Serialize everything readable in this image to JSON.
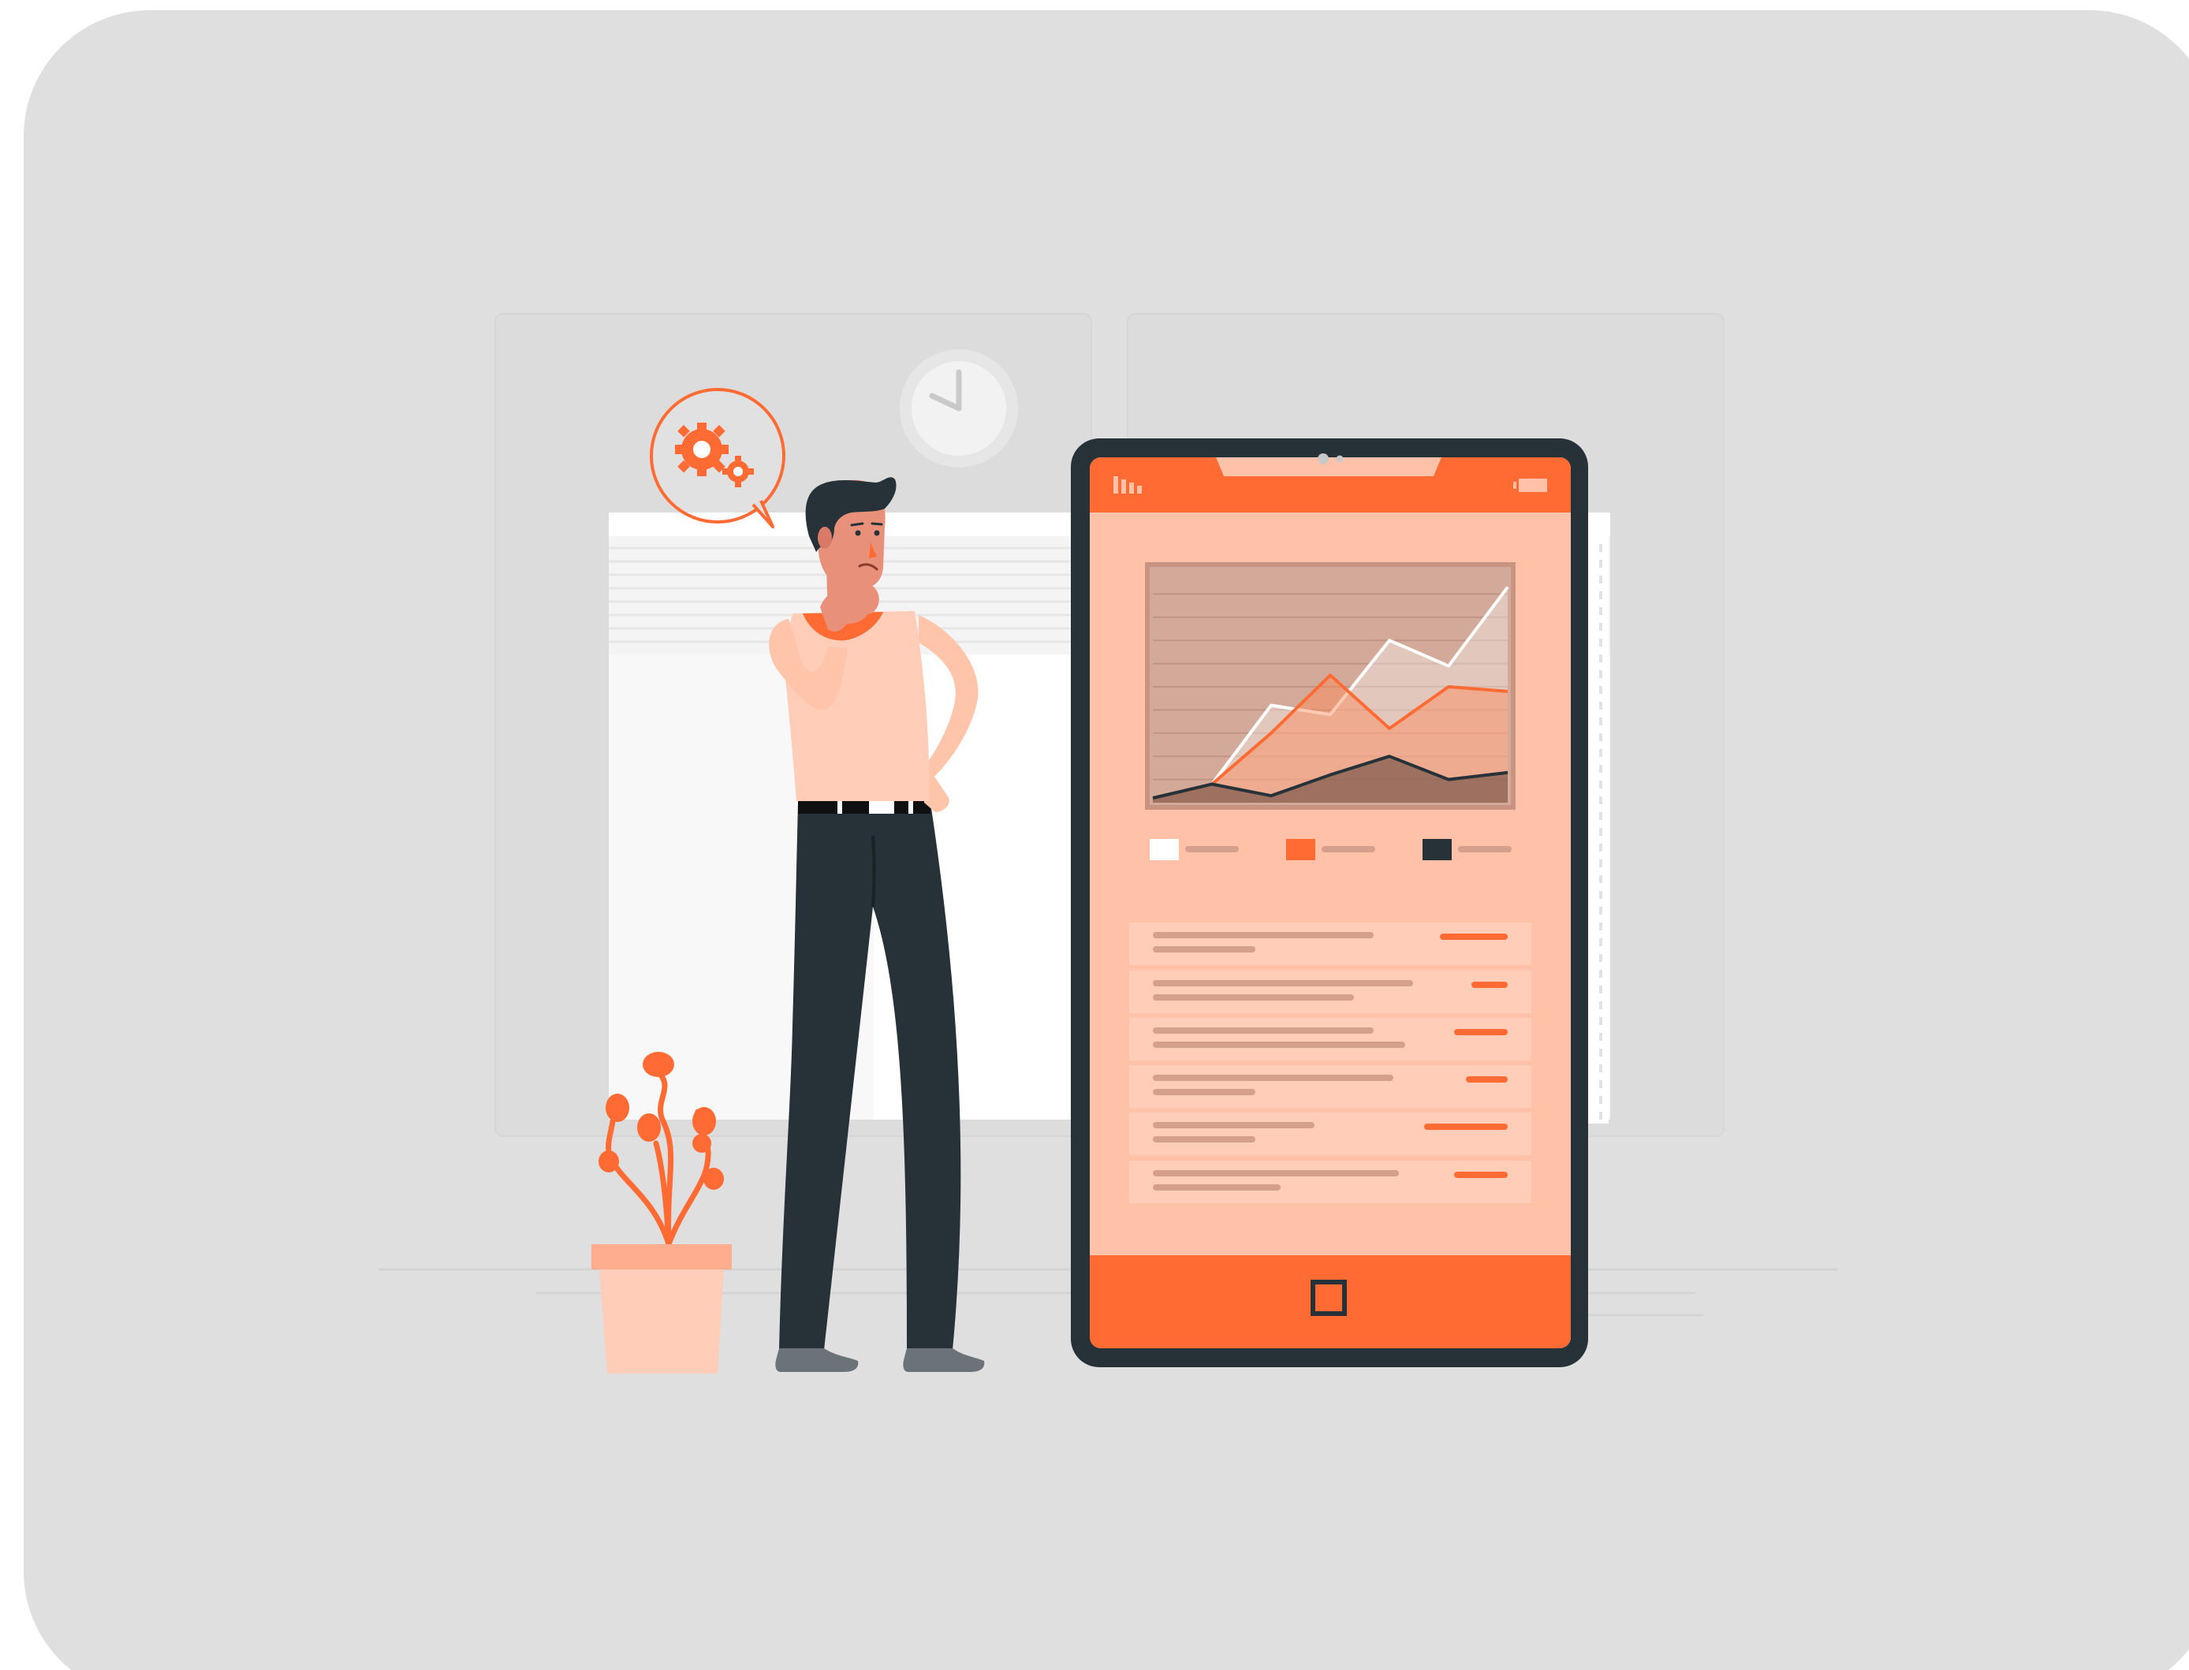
{
  "colors": {
    "background": "#ffffff",
    "card": "#dfdfdf",
    "accent": "#ff6b33",
    "accent_light": "#ffc1a8",
    "skin": "#e8907a",
    "dark": "#263238",
    "panel": "#f8f8f8"
  },
  "icons": {
    "thought": "gears-icon",
    "clock": "clock-icon",
    "signal": "signal-icon",
    "battery": "battery-icon",
    "home": "home-button-icon"
  },
  "phone": {
    "chart_legend_count": 3,
    "list_rows": 6
  },
  "chart_data": {
    "type": "area",
    "title": "",
    "xlabel": "",
    "ylabel": "",
    "x": [
      0,
      1,
      2,
      3,
      4,
      5,
      6
    ],
    "ylim": [
      0,
      100
    ],
    "series": [
      {
        "values": [
          2,
          8,
          42,
          38,
          70,
          59,
          93
        ],
        "color": "#ffffff"
      },
      {
        "values": [
          2,
          8,
          30,
          55,
          32,
          50,
          48
        ],
        "color": "#ff6b33"
      },
      {
        "values": [
          2,
          8,
          3,
          12,
          20,
          10,
          13
        ],
        "color": "#263238"
      }
    ]
  }
}
